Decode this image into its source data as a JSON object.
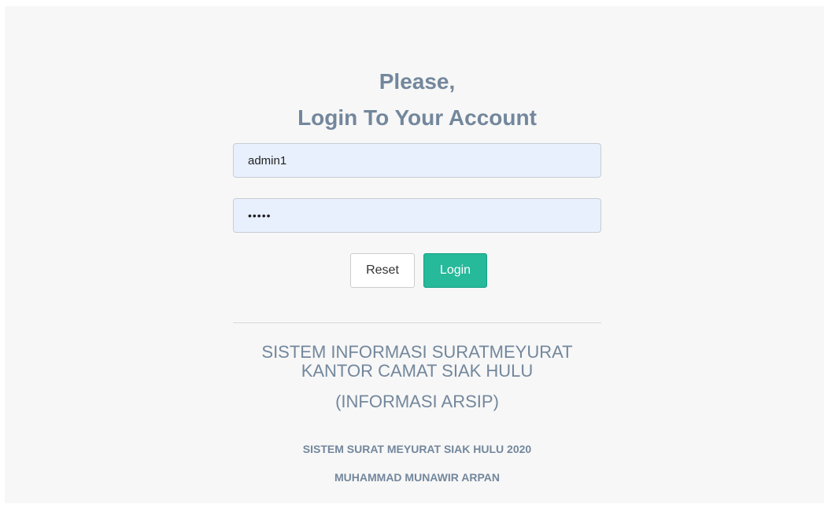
{
  "login": {
    "title_line1": "Please,",
    "title_line2": "Login To Your Account",
    "username_value": "admin1",
    "password_value": "•••••",
    "reset_label": "Reset",
    "login_label": "Login"
  },
  "system": {
    "line1": "SISTEM INFORMASI SURATMEYURAT",
    "line2": "KANTOR CAMAT SIAK HULU",
    "subtitle": "(INFORMASI ARSIP)"
  },
  "footer": {
    "line1": "SISTEM SURAT MEYURAT SIAK HULU 2020",
    "line2": "MUHAMMAD MUNAWIR ARPAN"
  },
  "colors": {
    "text": "#73879c",
    "login_button": "#26b99a",
    "input_background": "#e8f0fe",
    "page_background": "#f7f7f7"
  }
}
